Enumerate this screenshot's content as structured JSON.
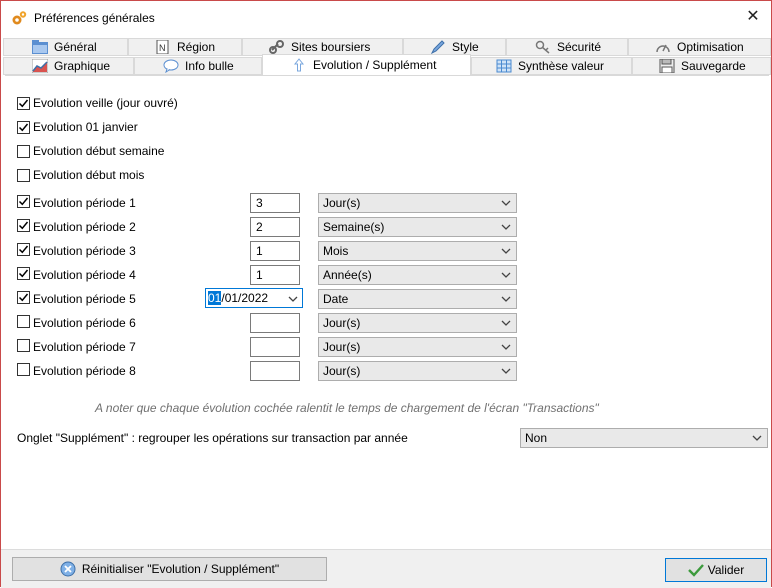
{
  "window": {
    "title": "Préférences générales"
  },
  "tabs_row1": [
    {
      "label": "Général",
      "icon": "folder-icon"
    },
    {
      "label": "Région",
      "icon": "map-icon"
    },
    {
      "label": "Sites boursiers",
      "icon": "link-icon"
    },
    {
      "label": "Style",
      "icon": "pen-icon"
    },
    {
      "label": "Sécurité",
      "icon": "key-icon"
    },
    {
      "label": "Optimisation",
      "icon": "gauge-icon"
    }
  ],
  "tabs_row2": [
    {
      "label": "Graphique",
      "icon": "chart-icon"
    },
    {
      "label": "Info bulle",
      "icon": "speech-bubble-icon"
    },
    {
      "label": "Evolution / Supplément",
      "icon": "arrow-up-icon",
      "active": true
    },
    {
      "label": "Synthèse valeur",
      "icon": "grid-icon"
    },
    {
      "label": "Sauvegarde",
      "icon": "floppy-disk-icon"
    }
  ],
  "options": [
    {
      "label": "Evolution veille (jour ouvré)",
      "checked": true
    },
    {
      "label": "Evolution 01 janvier",
      "checked": true
    },
    {
      "label": "Evolution début semaine",
      "checked": false
    },
    {
      "label": "Evolution début mois",
      "checked": false
    }
  ],
  "periods": [
    {
      "label": "Evolution période 1",
      "checked": true,
      "value": "3",
      "unit": "Jour(s)"
    },
    {
      "label": "Evolution période 2",
      "checked": true,
      "value": "2",
      "unit": "Semaine(s)"
    },
    {
      "label": "Evolution période 3",
      "checked": true,
      "value": "1",
      "unit": "Mois"
    },
    {
      "label": "Evolution période 4",
      "checked": true,
      "value": "1",
      "unit": "Année(s)"
    },
    {
      "label": "Evolution période 5",
      "checked": true,
      "date_day": "01",
      "date_rest": "/01/2022",
      "unit": "Date"
    },
    {
      "label": "Evolution période 6",
      "checked": false,
      "value": "",
      "unit": "Jour(s)"
    },
    {
      "label": "Evolution période 7",
      "checked": false,
      "value": "",
      "unit": "Jour(s)"
    },
    {
      "label": "Evolution période 8",
      "checked": false,
      "value": "",
      "unit": "Jour(s)"
    }
  ],
  "note": "A noter que chaque évolution cochée ralentit le temps de chargement de l'écran \"Transactions\"",
  "supplement": {
    "label": "Onglet \"Supplément\" : regrouper les opérations sur transaction par année",
    "value": "Non"
  },
  "buttons": {
    "reset": "Réinitialiser \"Evolution / Supplément\"",
    "validate": "Valider"
  },
  "colors": {
    "accent": "#0078d7",
    "check_green": "#3c9a3c"
  }
}
